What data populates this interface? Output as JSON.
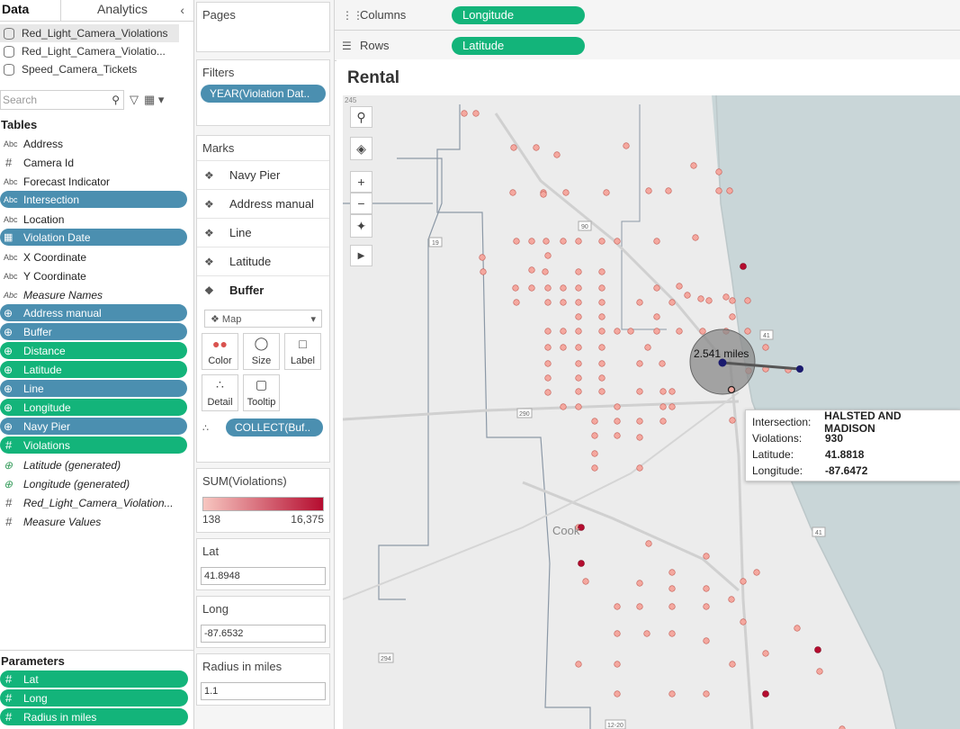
{
  "datapane": {
    "tab_data": "Data",
    "tab_analytics": "Analytics",
    "datasources": [
      "Red_Light_Camera_Violations",
      "Red_Light_Camera_Violatio...",
      "Speed_Camera_Tickets"
    ],
    "search_placeholder": "Search",
    "tables_header": "Tables",
    "fields": [
      {
        "icon": "Abc",
        "label": "Address"
      },
      {
        "icon": "#",
        "label": "Camera Id"
      },
      {
        "icon": "Abc",
        "label": "Forecast Indicator"
      },
      {
        "icon": "Abc",
        "label": "Intersection"
      },
      {
        "icon": "Abc",
        "label": "Location"
      },
      {
        "icon": "cal",
        "label": "Violation Date"
      },
      {
        "icon": "Abc",
        "label": "X Coordinate"
      },
      {
        "icon": "Abc",
        "label": "Y Coordinate"
      },
      {
        "icon": "Abc",
        "label": "Measure Names"
      },
      {
        "icon": "globe",
        "label": "Address manual"
      },
      {
        "icon": "globe",
        "label": "Buffer"
      },
      {
        "icon": "globe",
        "label": "Distance"
      },
      {
        "icon": "globe",
        "label": "Latitude"
      },
      {
        "icon": "globe",
        "label": "Line"
      },
      {
        "icon": "globe",
        "label": "Longitude"
      },
      {
        "icon": "globe",
        "label": "Navy Pier"
      },
      {
        "icon": "#",
        "label": "Violations"
      },
      {
        "icon": "globe",
        "label": "Latitude (generated)"
      },
      {
        "icon": "globe",
        "label": "Longitude (generated)"
      },
      {
        "icon": "#",
        "label": "Red_Light_Camera_Violation..."
      },
      {
        "icon": "#",
        "label": "Measure Values"
      }
    ],
    "parameters_header": "Parameters",
    "parameters": [
      "Lat",
      "Long",
      "Radius in miles"
    ]
  },
  "shelves": {
    "pages": "Pages",
    "filters": "Filters",
    "filter_pill": "YEAR(Violation Dat..",
    "marks": "Marks",
    "mark_layers": [
      "Navy Pier",
      "Address manual",
      "Line",
      "Latitude",
      "Buffer"
    ],
    "mark_type": "Map",
    "mark_buttons": [
      "Color",
      "Size",
      "Label",
      "Detail",
      "Tooltip"
    ],
    "collect_pill": "COLLECT(Buf..",
    "legend_title": "SUM(Violations)",
    "legend_min": "138",
    "legend_max": "16,375",
    "param_lat_label": "Lat",
    "param_lat_value": "41.8948",
    "param_long_label": "Long",
    "param_long_value": "-87.6532",
    "param_radius_label": "Radius in miles",
    "param_radius_value": "1.1"
  },
  "columns": {
    "label": "Columns",
    "pill": "Longitude"
  },
  "rows": {
    "label": "Rows",
    "pill": "Latitude"
  },
  "viz": {
    "title": "Rental",
    "buffer_label": "2.541 miles",
    "map_labels": [
      "Cook",
      "245",
      "19",
      "90",
      "41",
      "290",
      "294",
      "41",
      "12-20"
    ]
  },
  "tooltip": {
    "intersection_label": "Intersection:",
    "intersection_value": "HALSTED AND MADISON",
    "violations_label": "Violations:",
    "violations_value": "930",
    "latitude_label": "Latitude:",
    "latitude_value": "41.8818",
    "longitude_label": "Longitude:",
    "longitude_value": "-87.6472"
  },
  "colors": {
    "pill_blue": "#4b8fb0",
    "pill_green": "#13b47a",
    "lake": "#c9d6d8",
    "land": "#eeeeee",
    "point_low": "#f4a89f",
    "point_high": "#b50c2f",
    "buffer": "#8a8a8a"
  }
}
